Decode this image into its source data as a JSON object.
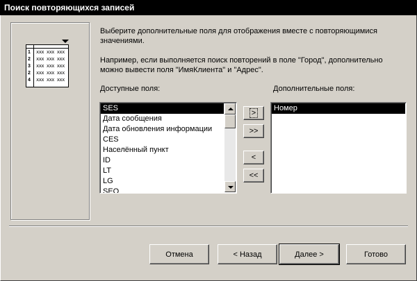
{
  "window": {
    "title": "Поиск повторяющихся записей"
  },
  "intro": {
    "line1": "Выберите дополнительные поля для отображения вместе с повторяющимися",
    "line2": "значениями.",
    "example1": "Например, если выполняется поиск повторений в поле \"Город\", дополнительно",
    "example2": "можно вывести поля \"ИмяКлиента\" и \"Адрес\"."
  },
  "illustration": {
    "rows": [
      {
        "n": "1",
        "x": "xxx xxx xxx"
      },
      {
        "n": "2",
        "x": "xxx xxx xxx"
      },
      {
        "n": "3",
        "x": "xxx xxx xxx"
      },
      {
        "n": "2",
        "x": "xxx xxx xxx"
      },
      {
        "n": "4",
        "x": "xxx xxx xxx"
      }
    ]
  },
  "available": {
    "label": "Доступные поля:",
    "items": [
      "SES",
      "Дата сообщения",
      "Дата обновления информации",
      "CES",
      "Населённый пункт",
      "ID",
      "LT",
      "LG",
      "SEO"
    ],
    "selected_index": 0
  },
  "selected_fields": {
    "label": "Дополнительные поля:",
    "items": [
      "Номер"
    ],
    "selected_index": 0
  },
  "transfer": {
    "add_one": ">",
    "add_all": ">>",
    "remove_one": "<",
    "remove_all": "<<"
  },
  "footer": {
    "cancel": "Отмена",
    "back": "< Назад",
    "next": "Далее >",
    "finish": "Готово"
  },
  "colors": {
    "face": "#d4d0c8",
    "selection": "#000000",
    "title_bg": "#000000"
  }
}
